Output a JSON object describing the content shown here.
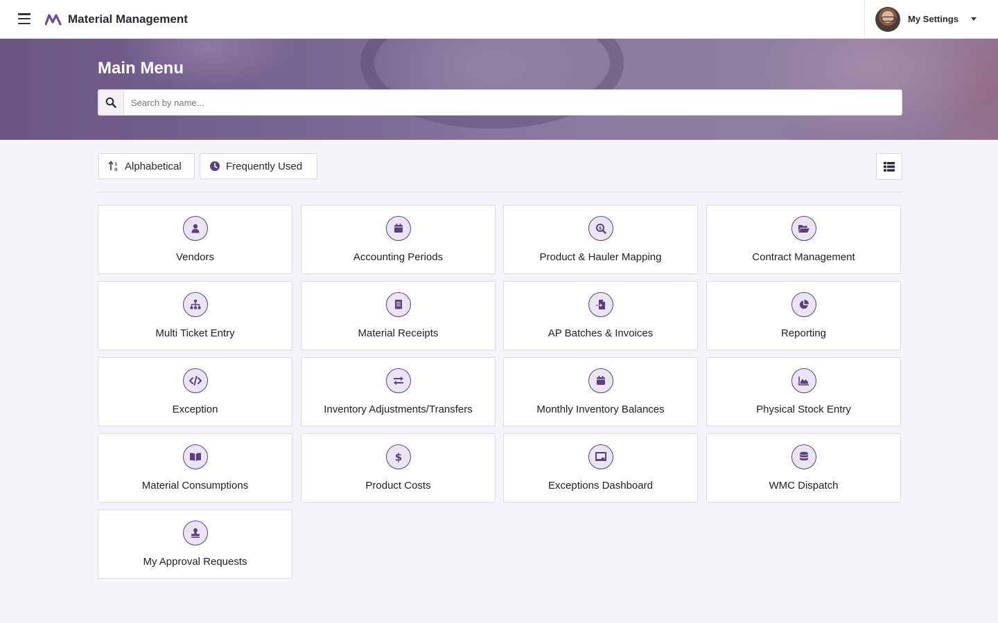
{
  "header": {
    "app_title": "Material Management",
    "settings_label": "My Settings"
  },
  "hero": {
    "title": "Main Menu",
    "search_placeholder": "Search by name..."
  },
  "toolbar": {
    "alphabetical_label": "Alphabetical",
    "frequently_used_label": "Frequently Used"
  },
  "colors": {
    "accent": "#5b3f82",
    "icon_background": "#ebe4f3",
    "page_background": "#f6f4fa"
  },
  "tiles": [
    {
      "label": "Vendors",
      "icon": "user-icon"
    },
    {
      "label": "Accounting Periods",
      "icon": "calendar-icon"
    },
    {
      "label": "Product & Hauler Mapping",
      "icon": "search-dollar-icon"
    },
    {
      "label": "Contract Management",
      "icon": "folder-open-icon"
    },
    {
      "label": "Multi Ticket Entry",
      "icon": "sitemap-icon"
    },
    {
      "label": "Material Receipts",
      "icon": "receipt-icon"
    },
    {
      "label": "AP Batches & Invoices",
      "icon": "file-import-icon"
    },
    {
      "label": "Reporting",
      "icon": "pie-chart-icon"
    },
    {
      "label": "Exception",
      "icon": "code-icon"
    },
    {
      "label": "Inventory Adjustments/Transfers",
      "icon": "exchange-icon"
    },
    {
      "label": "Monthly Inventory Balances",
      "icon": "calendar-icon"
    },
    {
      "label": "Physical Stock Entry",
      "icon": "area-chart-icon"
    },
    {
      "label": "Material Consumptions",
      "icon": "book-open-icon"
    },
    {
      "label": "Product Costs",
      "icon": "dollar-icon"
    },
    {
      "label": "Exceptions Dashboard",
      "icon": "chalkboard-icon"
    },
    {
      "label": "WMC Dispatch",
      "icon": "database-icon"
    },
    {
      "label": "My Approval Requests",
      "icon": "stamp-icon"
    }
  ]
}
